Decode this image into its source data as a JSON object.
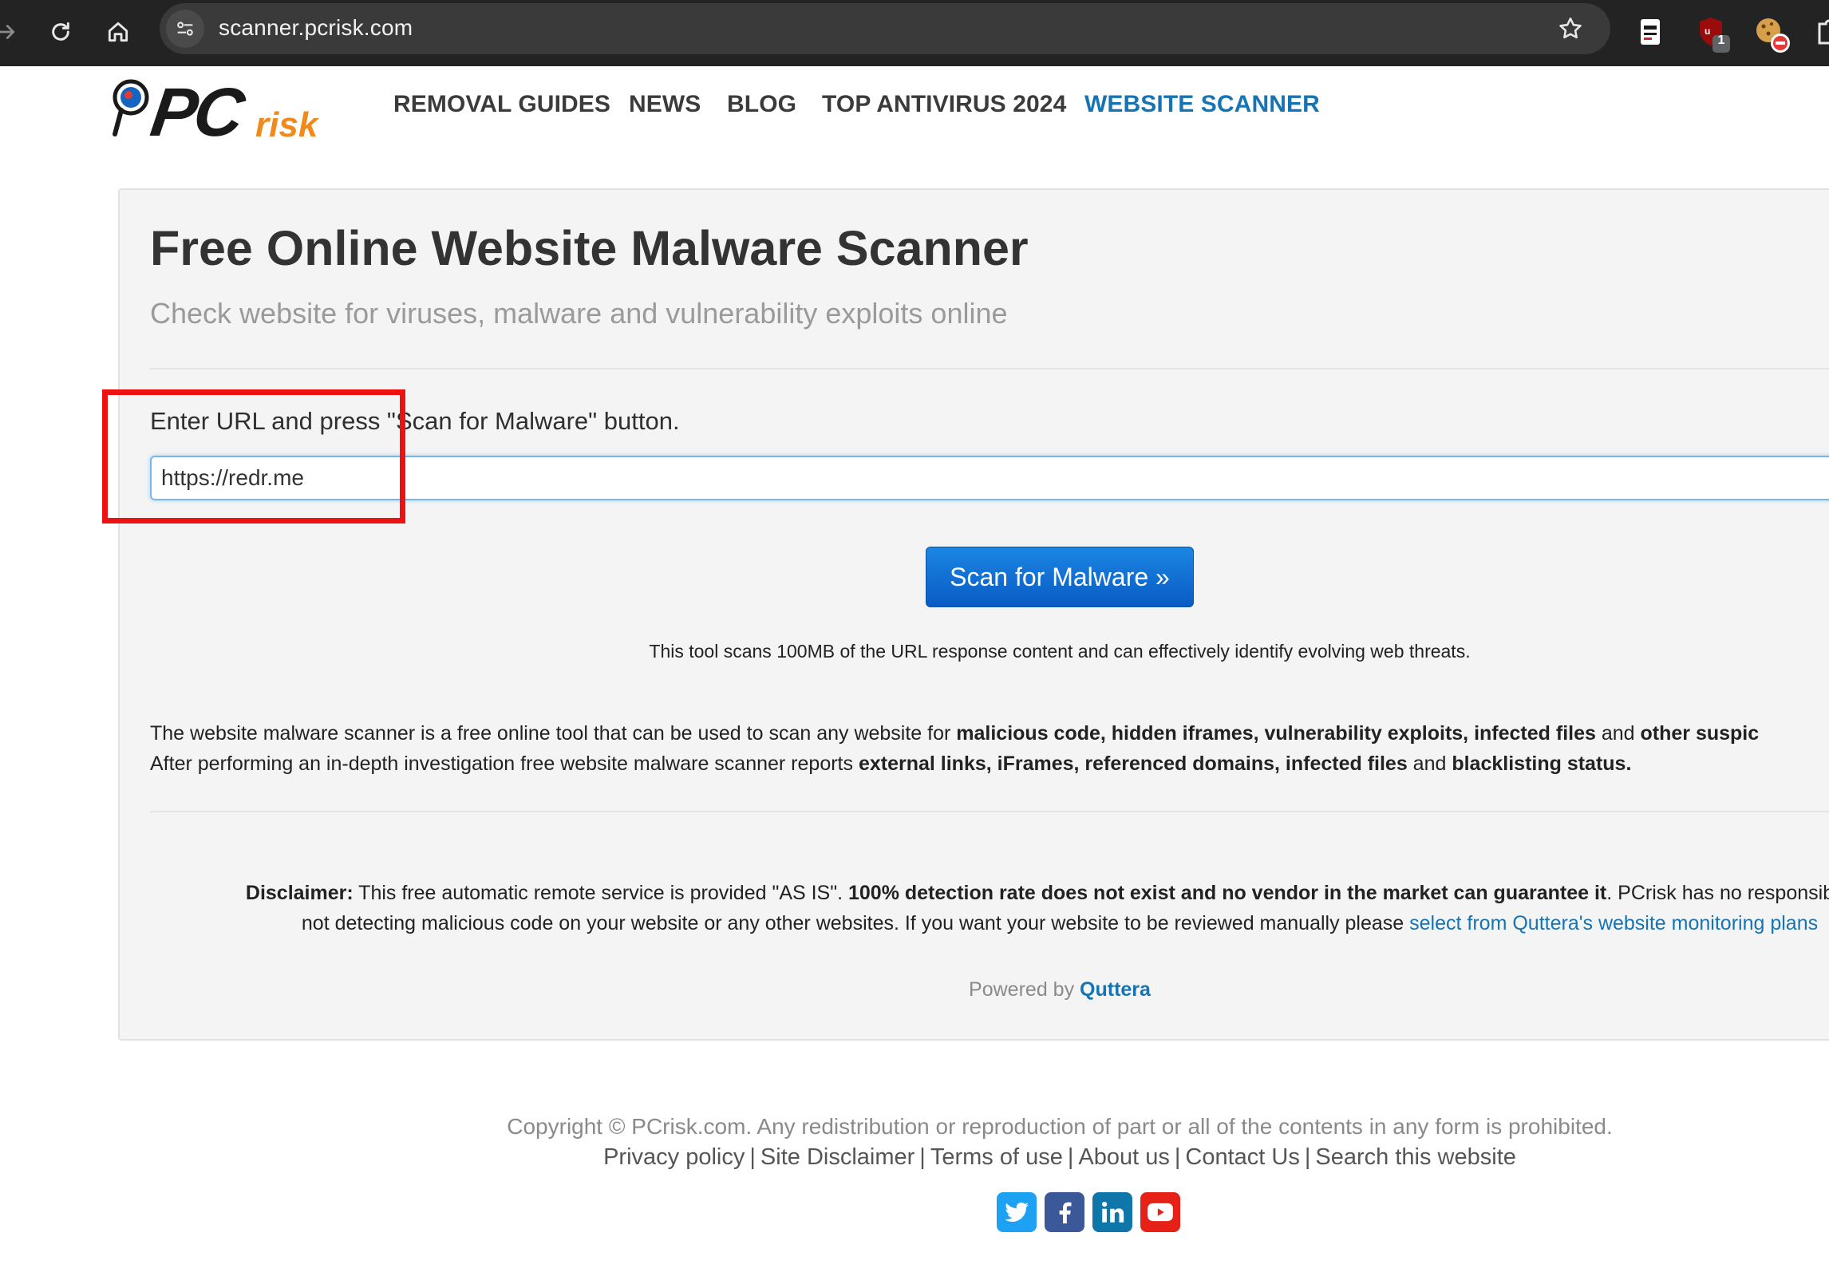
{
  "browser": {
    "url": "scanner.pcrisk.com",
    "icons": [
      "forward-icon",
      "reload-icon",
      "home-icon",
      "site-settings-icon",
      "bookmark-star-icon",
      "extension-icon",
      "ublock-icon",
      "cookie-extension-icon",
      "extensions-puzzle-icon"
    ],
    "ublock_count": "1"
  },
  "site": {
    "logo_text_main": "PC",
    "logo_text_sub": "risk",
    "nav": [
      "REMOVAL GUIDES",
      "NEWS",
      "BLOG",
      "TOP ANTIVIRUS 2024",
      "WEBSITE SCANNER"
    ],
    "active_nav": "WEBSITE SCANNER",
    "accent_color": "#1674b4"
  },
  "scanner": {
    "title": "Free Online Website Malware Scanner",
    "subtitle": "Check website for viruses, malware and vulnerability exploits online",
    "prompt": "Enter URL and press \"Scan for Malware\" button.",
    "url_value": "https://redr.me",
    "scan_button": "Scan for Malware »",
    "note": "This tool scans 100MB of the URL response content and can effectively identify evolving web threats.",
    "description": {
      "l1_a": "The website malware scanner is a free online tool that can be used to scan any website for ",
      "l1_b": "malicious code, hidden iframes, vulnerability exploits, infected files",
      "l1_c": " and ",
      "l1_d": "other suspic",
      "l2_a": "After performing an in-depth investigation free website malware scanner reports ",
      "l2_b": "external links, iFrames, referenced domains, infected files",
      "l2_c": " and ",
      "l2_d": "blacklisting status."
    },
    "disclaimer": {
      "label": "Disclaimer:",
      "l1_a": " This free automatic remote service is provided \"AS IS\". ",
      "l1_b": "100% detection rate does not exist and no vendor in the market can guarantee it",
      "l1_c": ". PCrisk has no responsibility f",
      "l2_a": "not detecting malicious code on your website or any other websites. If you want your website to be reviewed manually please ",
      "l2_link": "select from Quttera's website monitoring plans"
    },
    "powered_by": "Powered by",
    "powered_link": "Quttera"
  },
  "footer": {
    "copyright": "Copyright © PCrisk.com. Any redistribution or reproduction of part or all of the contents in any form is prohibited.",
    "links": [
      "Privacy policy",
      "Site Disclaimer",
      "Terms of use",
      "About us",
      "Contact Us",
      "Search this website"
    ],
    "social": [
      {
        "name": "twitter-icon",
        "color": "#1da1f2"
      },
      {
        "name": "facebook-icon",
        "color": "#3b5998"
      },
      {
        "name": "linkedin-icon",
        "color": "#0e76a8"
      },
      {
        "name": "youtube-icon",
        "color": "#e62117"
      }
    ]
  },
  "annotation": {
    "highlight_color": "#ee1111"
  }
}
